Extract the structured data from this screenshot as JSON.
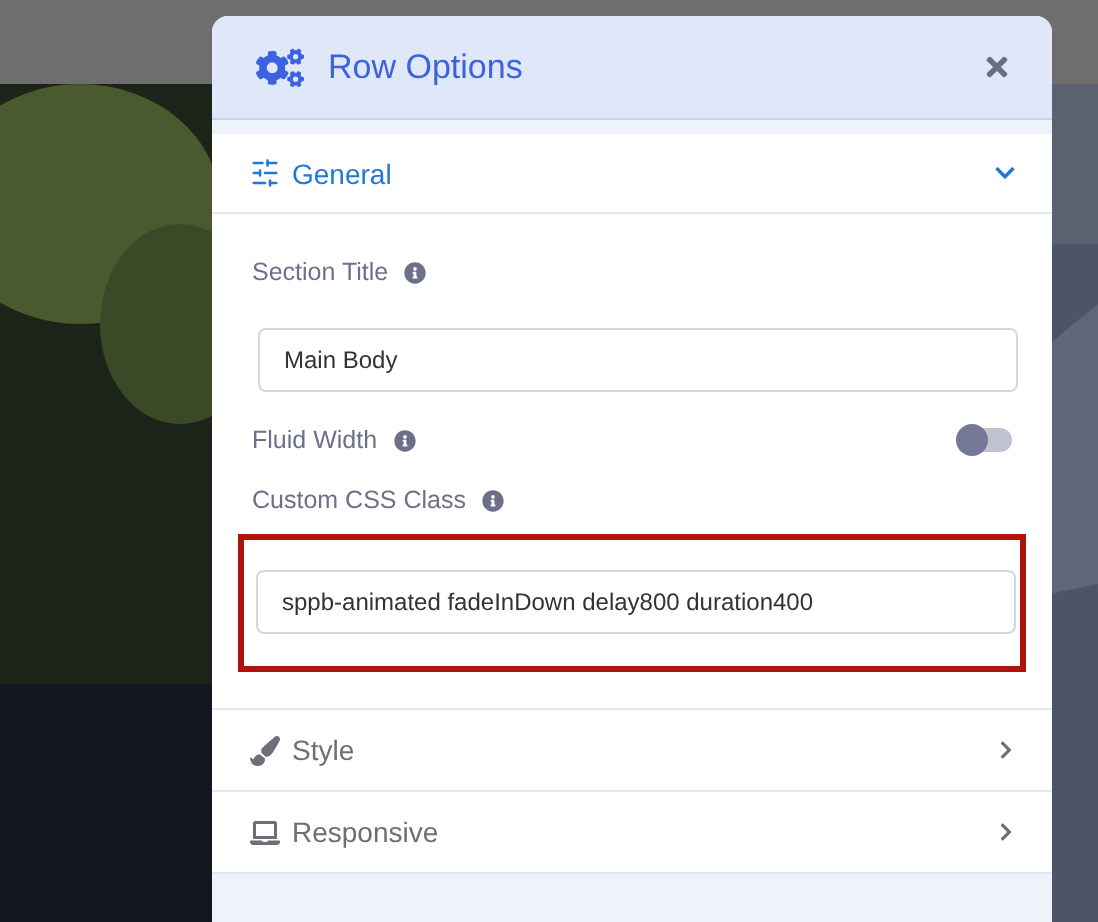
{
  "dialog": {
    "title": "Row Options",
    "sections": [
      {
        "label": "General",
        "expanded": true
      },
      {
        "label": "Style",
        "expanded": false
      },
      {
        "label": "Responsive",
        "expanded": false
      }
    ],
    "fields": [
      {
        "kind": "text",
        "label": "Section Title",
        "value": "Main Body",
        "highlighted": false
      },
      {
        "kind": "toggle",
        "label": "Fluid Width",
        "on": false
      },
      {
        "kind": "text",
        "label": "Custom CSS Class",
        "value": "sppb-animated fadeInDown delay800 duration400",
        "highlighted": true
      }
    ]
  }
}
